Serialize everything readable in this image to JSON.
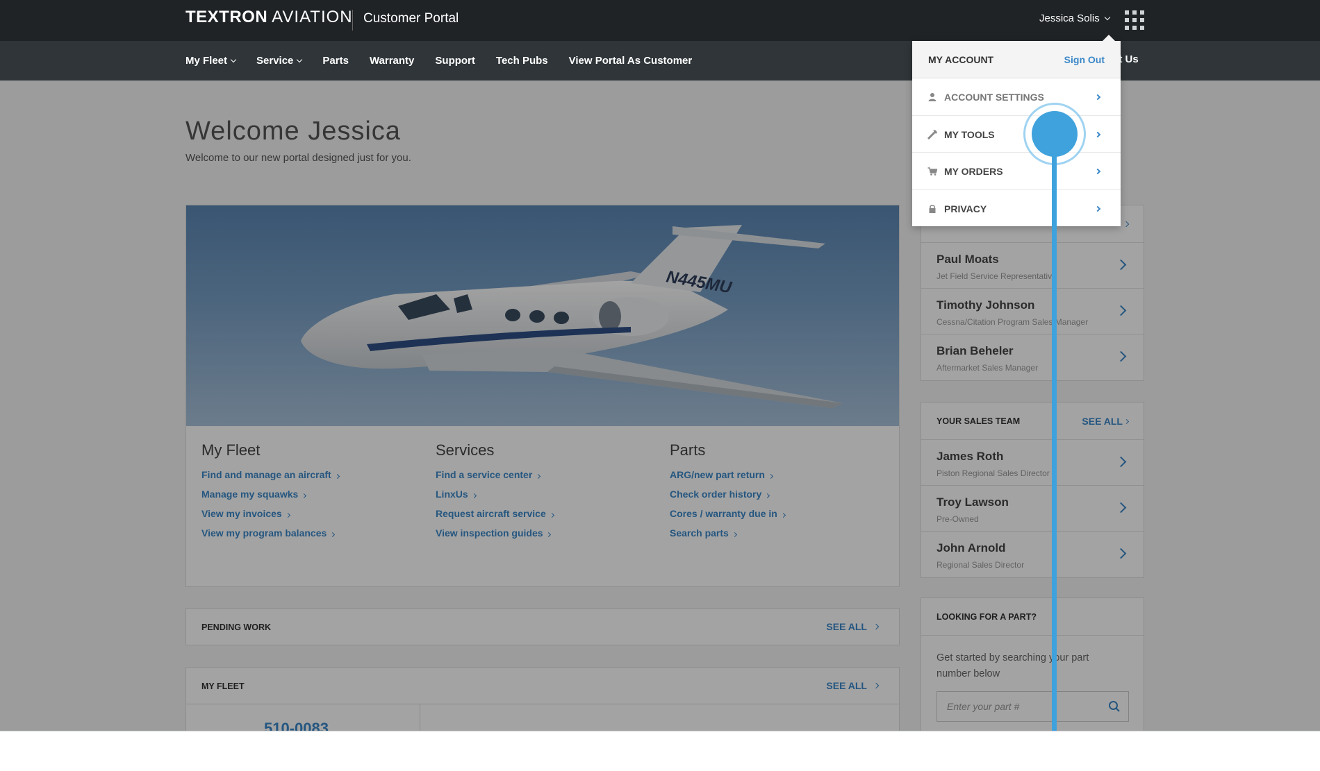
{
  "header": {
    "brand_bold": "TEXTRON",
    "brand_light": "AVIATION",
    "portal_name": "Customer Portal",
    "user_name": "Jessica Solis"
  },
  "nav": {
    "items": [
      {
        "label": "My Fleet",
        "has_dropdown": true
      },
      {
        "label": "Service",
        "has_dropdown": true
      },
      {
        "label": "Parts",
        "has_dropdown": false
      },
      {
        "label": "Warranty",
        "has_dropdown": false
      },
      {
        "label": "Support",
        "has_dropdown": false
      },
      {
        "label": "Tech Pubs",
        "has_dropdown": false
      },
      {
        "label": "View Portal As Customer",
        "has_dropdown": false
      }
    ],
    "right_partial": "ct Us"
  },
  "welcome": {
    "title": "Welcome Jessica",
    "subtitle": "Welcome to our new portal designed just for you."
  },
  "hero": {
    "tail_number": "N445MU",
    "columns": [
      {
        "title": "My Fleet",
        "links": [
          "Find and manage an aircraft",
          "Manage my squawks",
          "View my invoices",
          "View my program balances"
        ]
      },
      {
        "title": "Services",
        "links": [
          "Find a service center",
          "LinxUs",
          "Request aircraft service",
          "View inspection guides"
        ]
      },
      {
        "title": "Parts",
        "links": [
          "ARG/new part return",
          "Check order history",
          "Cores / warranty due in",
          "Search parts"
        ]
      }
    ]
  },
  "pending_work": {
    "title": "PENDING WORK",
    "see_all": "SEE ALL"
  },
  "my_fleet_panel": {
    "title": "MY FLEET",
    "see_all": "SEE ALL",
    "tail_partial": "510-0083"
  },
  "service_team": {
    "people": [
      {
        "name": "Paul Moats",
        "role": "Jet Field Service Representative"
      },
      {
        "name": "Timothy Johnson",
        "role": "Cessna/Citation Program Sales Manager"
      },
      {
        "name": "Brian Beheler",
        "role": "Aftermarket Sales Manager"
      }
    ]
  },
  "sales_team": {
    "title": "YOUR SALES TEAM",
    "see_all": "SEE ALL",
    "people": [
      {
        "name": "James Roth",
        "role": "Piston Regional Sales Director"
      },
      {
        "name": "Troy Lawson",
        "role": "Pre-Owned"
      },
      {
        "name": "John Arnold",
        "role": "Regional Sales Director"
      }
    ]
  },
  "part_lookup": {
    "title": "LOOKING FOR A PART?",
    "text": "Get started by searching your part number below",
    "placeholder": "Enter your part #"
  },
  "account_menu": {
    "title": "MY ACCOUNT",
    "sign_out": "Sign Out",
    "items": [
      {
        "label": "ACCOUNT SETTINGS",
        "icon": "user-icon"
      },
      {
        "label": "MY TOOLS",
        "icon": "wrench-icon"
      },
      {
        "label": "MY ORDERS",
        "icon": "cart-icon"
      },
      {
        "label": "PRIVACY",
        "icon": "lock-icon"
      }
    ]
  },
  "colors": {
    "topbar": "#1f2326",
    "navbar": "#2f3538",
    "link": "#3a87c8",
    "cursor": "#3fa2dc"
  }
}
